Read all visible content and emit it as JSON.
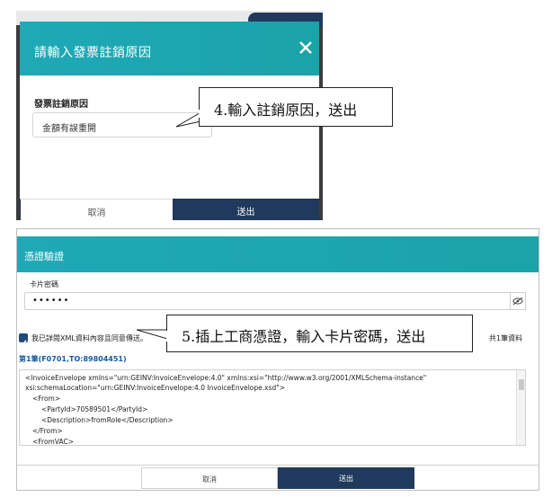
{
  "dialog1": {
    "title": "請輸入發票註銷原因",
    "field_label": "發票註銷原因",
    "field_value": "金額有誤重開",
    "cancel_label": "取消",
    "send_label": "送出"
  },
  "callout1": {
    "text": "4.輸入註銷原因，送出"
  },
  "dialog2": {
    "title": "憑證驗證",
    "password_label": "卡片密碼",
    "password_value": "••••••",
    "consent_label": "我已詳閱XML資料內容且同意傳送。",
    "count_label": "共1筆資料",
    "record_label": "第1筆(F0701,TO:89804451)",
    "xml_lines": [
      "<InvoiceEnvelope xmlns=\"urn:GEINV:InvoiceEnvelope:4.0\" xmlns:xsi=\"http://www.w3.org/2001/XMLSchema-instance\"",
      "xsi:schemaLocation=\"urn:GEINV:InvoiceEnvelope:4.0 InvoiceEnvelope.xsd\">",
      "<From>",
      "<PartyId>70589501</PartyId>",
      "<Description>fromRole</Description>",
      "</From>",
      "<FromVAC>"
    ],
    "cancel_label": "取消",
    "send_label": "送出"
  },
  "callout2": {
    "text": "5.插上工商憑證，輸入卡片密碼，送出"
  },
  "colors": {
    "header_teal": "#1fa9b7",
    "button_navy": "#1f3a5c",
    "link_blue": "#1a5aa0"
  }
}
